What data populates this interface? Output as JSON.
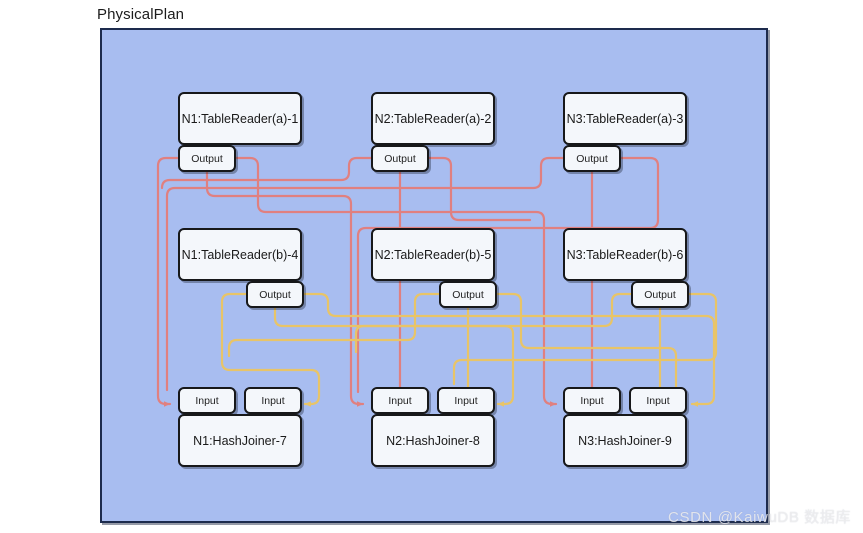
{
  "diagram": {
    "title": "PhysicalPlan",
    "panel": {
      "background_color": "#a8bdf0",
      "border_color": "#1d2b4d"
    },
    "edge_colors": {
      "table_a": "#e08080",
      "table_b": "#e8c468"
    },
    "rows": [
      {
        "id": "row-tablereader-a",
        "port_label": "Output",
        "port_align": "left",
        "nodes": [
          {
            "id": "n1",
            "label": "N1:TableReader(a)-1"
          },
          {
            "id": "n2",
            "label": "N2:TableReader(a)-2"
          },
          {
            "id": "n3",
            "label": "N3:TableReader(a)-3"
          }
        ]
      },
      {
        "id": "row-tablereader-b",
        "port_label": "Output",
        "port_align": "right",
        "nodes": [
          {
            "id": "n4",
            "label": "N1:TableReader(b)-4"
          },
          {
            "id": "n5",
            "label": "N2:TableReader(b)-5"
          },
          {
            "id": "n6",
            "label": "N3:TableReader(b)-6"
          }
        ]
      },
      {
        "id": "row-hashjoiner",
        "port_label": "Input",
        "port_align": "both",
        "nodes": [
          {
            "id": "n7",
            "label": "N1:HashJoiner-7"
          },
          {
            "id": "n8",
            "label": "N2:HashJoiner-8"
          },
          {
            "id": "n9",
            "label": "N3:HashJoiner-9"
          }
        ]
      }
    ]
  },
  "watermark": {
    "text": "CSDN @KaiwuDB 数据库"
  }
}
